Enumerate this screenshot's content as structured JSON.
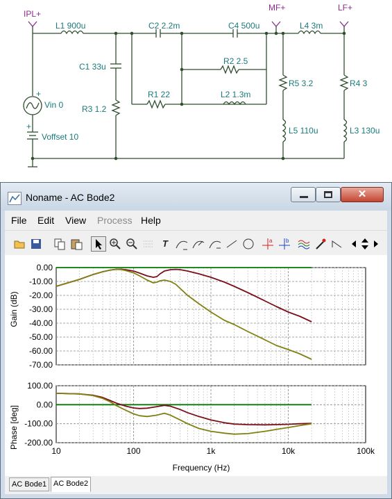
{
  "schematic": {
    "nodes": {
      "ipl": "IPL+",
      "mf": "MF+",
      "lf": "LF+"
    },
    "components": {
      "l1": "L1 900u",
      "c2": "C2 2.2m",
      "c4": "C4 500u",
      "l4": "L4 3m",
      "c1": "C1 33u",
      "r3": "R3 1.2",
      "r2": "R2 2.5",
      "r1": "R1 22",
      "l2": "L2 1.3m",
      "r5": "R5 3.2",
      "r4": "R4 3",
      "l5": "L5 110u",
      "l3": "L3 130u",
      "vin": "Vin 0",
      "voffset": "Voffset 10",
      "plus1": "+",
      "plus2": "+"
    }
  },
  "window": {
    "title": "Noname - AC Bode2",
    "close_glyph": "✕"
  },
  "menu": [
    "File",
    "Edit",
    "View",
    "Process",
    "Help"
  ],
  "toolbar": {
    "icons": [
      "open-folder-icon",
      "save-icon",
      "copy-icon",
      "paste-icon",
      "pointer-icon",
      "zoom-in-icon",
      "zoom-out-icon",
      "grid-icon",
      "text-icon",
      "curve-a-icon",
      "curve-b-icon",
      "curve-c-icon",
      "line-icon",
      "circle-icon",
      "cursor-a-icon",
      "cursor-b-icon",
      "waves-icon",
      "probe-icon",
      "step-icon",
      "arrow-left-icon",
      "arrow-updown-icon",
      "arrow-right-icon"
    ],
    "text_glyph": "T",
    "cursor_a": "a",
    "cursor_b": "b"
  },
  "tabs": [
    "AC Bode1",
    "AC Bode2"
  ],
  "colors": {
    "series1": "#7a0f1a",
    "series2": "#808012",
    "zero_line": "#007a00"
  },
  "chart_data": [
    {
      "type": "line",
      "xscale": "log",
      "xlim": [
        10,
        100000
      ],
      "x_ticks": [
        "10",
        "100",
        "1k",
        "10k",
        "100k"
      ],
      "ylabel": "Gain (dB)",
      "ylim": [
        -70,
        0
      ],
      "y_ticks": [
        "0.00",
        "-10.00",
        "-20.00",
        "-30.00",
        "-40.00",
        "-50.00",
        "-60.00",
        "-70.00"
      ],
      "grid": true,
      "series": [
        {
          "x": [
            10,
            20,
            30,
            40,
            50,
            60,
            70,
            80,
            100,
            120,
            150,
            180,
            200,
            220,
            250,
            300,
            350,
            400,
            500,
            700,
            1000,
            1500,
            2000,
            3000,
            5000,
            7000,
            10000,
            14000,
            20000
          ],
          "values": [
            -13.5,
            -8.5,
            -5,
            -3,
            -1.8,
            -1.2,
            -1.2,
            -1.6,
            -2.5,
            -4,
            -6,
            -7,
            -6.5,
            -4.5,
            -2.5,
            -1.5,
            -1.3,
            -1.5,
            -2.5,
            -4.5,
            -7,
            -10.5,
            -13.5,
            -18,
            -24,
            -28,
            -32,
            -35,
            -39
          ]
        },
        {
          "x": [
            10,
            20,
            30,
            40,
            50,
            60,
            70,
            80,
            100,
            120,
            150,
            180,
            200,
            220,
            250,
            300,
            350,
            400,
            500,
            700,
            1000,
            1500,
            2000,
            3000,
            5000,
            7000,
            10000,
            14000,
            20000
          ],
          "values": [
            -13.5,
            -8.5,
            -5,
            -3,
            -1.8,
            -1.3,
            -1.5,
            -2.2,
            -3.8,
            -6,
            -9,
            -11,
            -10.5,
            -9.5,
            -9,
            -10,
            -12,
            -15,
            -20,
            -26,
            -32,
            -38,
            -41,
            -46,
            -52,
            -56,
            -59,
            -62,
            -66
          ]
        }
      ]
    },
    {
      "type": "line",
      "xscale": "log",
      "xlim": [
        10,
        100000
      ],
      "x_ticks": [
        "10",
        "100",
        "1k",
        "10k",
        "100k"
      ],
      "xlabel": "Frequency (Hz)",
      "ylabel": "Phase [deg]",
      "ylim": [
        -200,
        100
      ],
      "y_ticks": [
        "100.00",
        "0.00",
        "-100.00",
        "-200.00"
      ],
      "grid": true,
      "series": [
        {
          "x": [
            10,
            20,
            30,
            40,
            50,
            60,
            80,
            100,
            120,
            150,
            200,
            250,
            300,
            400,
            500,
            700,
            1000,
            1500,
            2000,
            3000,
            5000,
            7000,
            10000,
            14000,
            20000
          ],
          "values": [
            60,
            57,
            50,
            38,
            22,
            8,
            -8,
            -17,
            -20,
            -18,
            -10,
            -3,
            -8,
            -25,
            -42,
            -62,
            -80,
            -95,
            -102,
            -105,
            -106,
            -105,
            -103,
            -100,
            -98
          ]
        },
        {
          "x": [
            10,
            20,
            30,
            40,
            50,
            60,
            80,
            100,
            120,
            150,
            200,
            250,
            300,
            400,
            500,
            700,
            1000,
            1500,
            2000,
            3000,
            5000,
            7000,
            10000,
            14000,
            20000
          ],
          "values": [
            60,
            57,
            48,
            33,
            15,
            -5,
            -30,
            -48,
            -58,
            -62,
            -55,
            -45,
            -55,
            -80,
            -100,
            -125,
            -140,
            -150,
            -155,
            -152,
            -140,
            -130,
            -120,
            -110,
            -100
          ]
        }
      ]
    }
  ]
}
